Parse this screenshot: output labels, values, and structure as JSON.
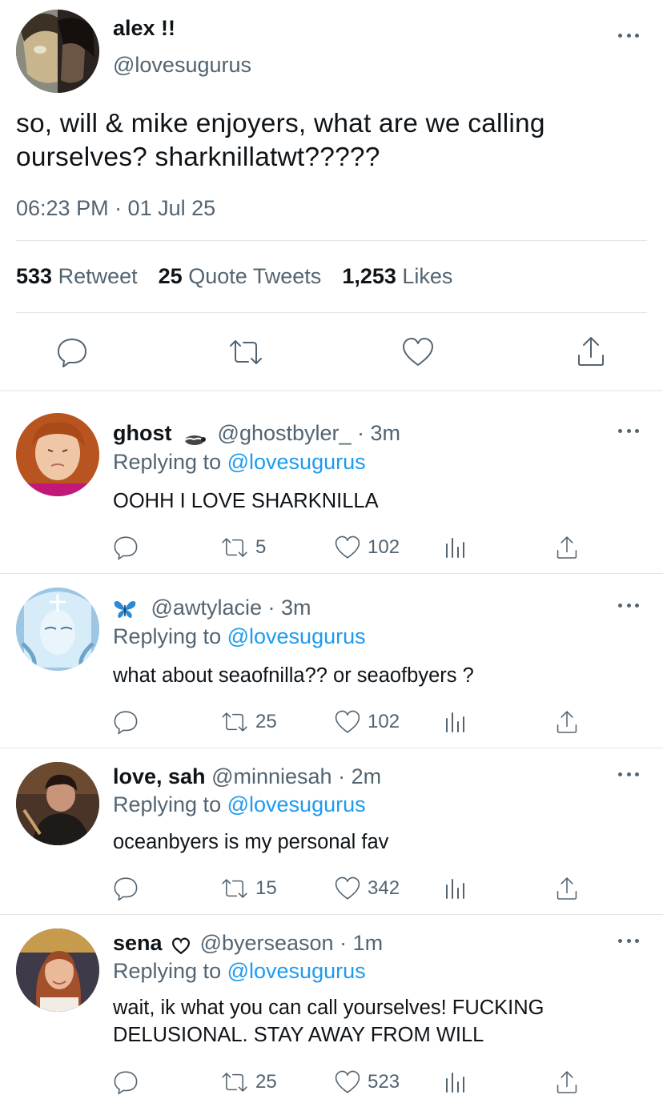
{
  "main_tweet": {
    "display_name": "alex !!",
    "handle": "@lovesugurus",
    "text": "so, will & mike enjoyers, what are we calling ourselves? sharknillatwt?????",
    "timestamp": "06:23 PM · 01 Jul 25",
    "stats": {
      "retweets_count": "533",
      "retweets_label": "Retweet",
      "quotes_count": "25",
      "quotes_label": "Quote Tweets",
      "likes_count": "1,253",
      "likes_label": "Likes"
    },
    "actions": [
      "reply-icon",
      "retweet-icon",
      "like-icon",
      "share-icon"
    ]
  },
  "replies": [
    {
      "display_name": "ghost",
      "name_emoji": "badger",
      "handle": "@ghostbyler_",
      "time": "· 3m",
      "replying_prefix": "Replying to",
      "replying_to": "@lovesugurus",
      "text": "OOHH I LOVE SHARKNILLA",
      "retweets": "5",
      "likes": "102"
    },
    {
      "display_name": "",
      "name_emoji": "butterfly",
      "handle": "@awtylacie",
      "time": "· 3m",
      "replying_prefix": "Replying to",
      "replying_to": "@lovesugurus",
      "text": "what about seaofnilla?? or seaofbyers ?",
      "retweets": "25",
      "likes": "102"
    },
    {
      "display_name": "love, sah",
      "handle": "@minniesah",
      "time": "· 2m",
      "replying_prefix": "Replying to",
      "replying_to": "@lovesugurus",
      "text": "oceanbyers is my personal fav",
      "retweets": "15",
      "likes": "342"
    },
    {
      "display_name": "sena",
      "name_emoji": "heart",
      "handle": "@byerseason",
      "time": "· 1m",
      "replying_prefix": "Replying to",
      "replying_to": "@lovesugurus",
      "text": "wait, ik what you can call yourselves! FUCKING DELUSIONAL. STAY AWAY FROM WILL",
      "retweets": "25",
      "likes": "523"
    }
  ],
  "colors": {
    "text": "#0f1419",
    "secondary": "#536471",
    "link": "#1d9bf0",
    "divider": "#e1e5e8"
  }
}
